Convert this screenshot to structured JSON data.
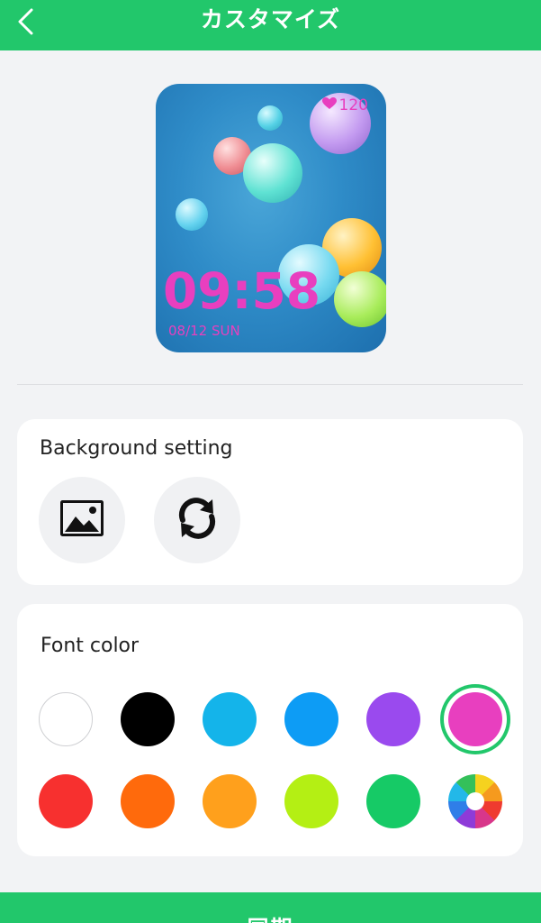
{
  "header": {
    "title": "カスタマイズ",
    "back_icon": "chevron-left-icon",
    "color": "#22c76b"
  },
  "watch_preview": {
    "heart_rate": "120",
    "time": "09:58",
    "date": "08/12 SUN",
    "font_color": "#e83fbf"
  },
  "background_setting": {
    "title": "Background setting",
    "buttons": [
      {
        "icon": "image-icon"
      },
      {
        "icon": "refresh-icon"
      }
    ]
  },
  "font_color": {
    "title": "Font color",
    "selected": "#e83fbf",
    "swatches": [
      "#ffffff",
      "#000000",
      "#14b4ea",
      "#0d9cf5",
      "#9a4aee",
      "#e83fbf",
      "#f7302f",
      "#ff6a0c",
      "#ffa01c",
      "#b4ef14",
      "#16ca66",
      "color-wheel"
    ]
  },
  "footer": {
    "sync_label": "同期"
  }
}
